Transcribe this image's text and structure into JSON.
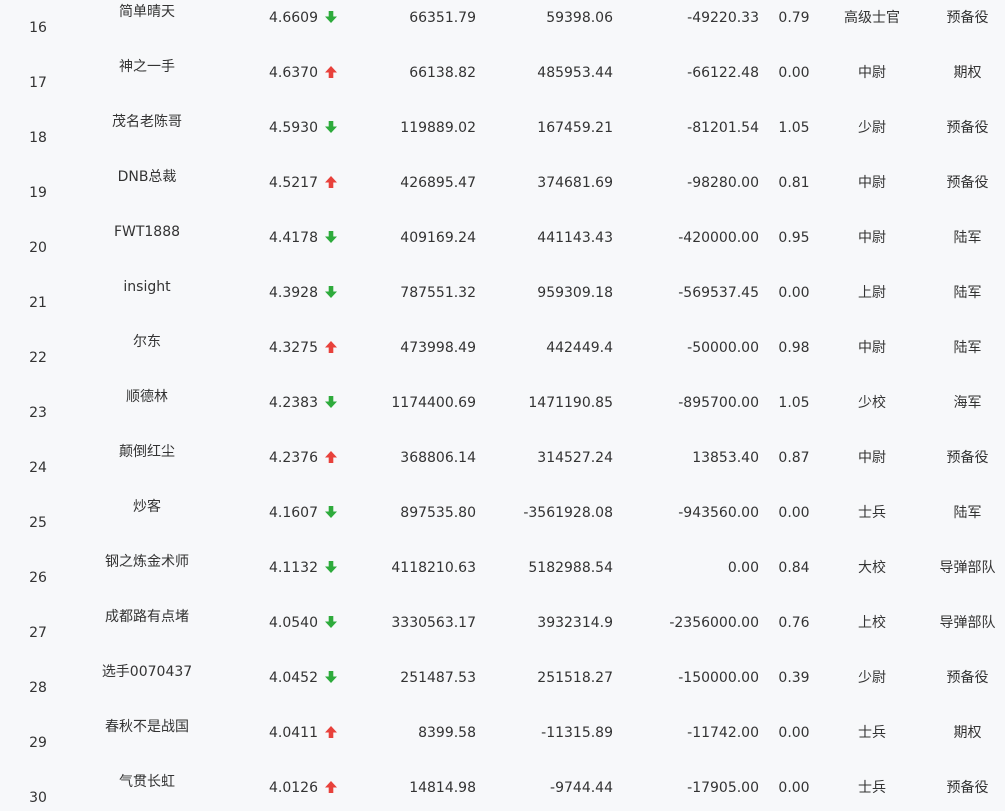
{
  "colors": {
    "up": "#e8413b",
    "down": "#2eab3c",
    "text": "#333333",
    "background": "#f7f8fa"
  },
  "rows": [
    {
      "rank": "16",
      "name": "简单晴天",
      "score": "4.6609",
      "trend": "down",
      "v1": "66351.79",
      "v2": "59398.06",
      "v3": "-49220.33",
      "ratio": "0.79",
      "level": "高级士官",
      "type": "预备役"
    },
    {
      "rank": "17",
      "name": "神之一手",
      "score": "4.6370",
      "trend": "up",
      "v1": "66138.82",
      "v2": "485953.44",
      "v3": "-66122.48",
      "ratio": "0.00",
      "level": "中尉",
      "type": "期权"
    },
    {
      "rank": "18",
      "name": "茂名老陈哥",
      "score": "4.5930",
      "trend": "down",
      "v1": "119889.02",
      "v2": "167459.21",
      "v3": "-81201.54",
      "ratio": "1.05",
      "level": "少尉",
      "type": "预备役"
    },
    {
      "rank": "19",
      "name": "DNB总裁",
      "score": "4.5217",
      "trend": "up",
      "v1": "426895.47",
      "v2": "374681.69",
      "v3": "-98280.00",
      "ratio": "0.81",
      "level": "中尉",
      "type": "预备役"
    },
    {
      "rank": "20",
      "name": "FWT1888",
      "score": "4.4178",
      "trend": "down",
      "v1": "409169.24",
      "v2": "441143.43",
      "v3": "-420000.00",
      "ratio": "0.95",
      "level": "中尉",
      "type": "陆军"
    },
    {
      "rank": "21",
      "name": "insight",
      "score": "4.3928",
      "trend": "down",
      "v1": "787551.32",
      "v2": "959309.18",
      "v3": "-569537.45",
      "ratio": "0.00",
      "level": "上尉",
      "type": "陆军"
    },
    {
      "rank": "22",
      "name": "尔东",
      "score": "4.3275",
      "trend": "up",
      "v1": "473998.49",
      "v2": "442449.4",
      "v3": "-50000.00",
      "ratio": "0.98",
      "level": "中尉",
      "type": "陆军"
    },
    {
      "rank": "23",
      "name": "顺德林",
      "score": "4.2383",
      "trend": "down",
      "v1": "1174400.69",
      "v2": "1471190.85",
      "v3": "-895700.00",
      "ratio": "1.05",
      "level": "少校",
      "type": "海军"
    },
    {
      "rank": "24",
      "name": "颠倒红尘",
      "score": "4.2376",
      "trend": "up",
      "v1": "368806.14",
      "v2": "314527.24",
      "v3": "13853.40",
      "ratio": "0.87",
      "level": "中尉",
      "type": "预备役"
    },
    {
      "rank": "25",
      "name": "炒客",
      "score": "4.1607",
      "trend": "down",
      "v1": "897535.80",
      "v2": "-3561928.08",
      "v3": "-943560.00",
      "ratio": "0.00",
      "level": "士兵",
      "type": "陆军"
    },
    {
      "rank": "26",
      "name": "钢之炼金术师",
      "score": "4.1132",
      "trend": "down",
      "v1": "4118210.63",
      "v2": "5182988.54",
      "v3": "0.00",
      "ratio": "0.84",
      "level": "大校",
      "type": "导弹部队"
    },
    {
      "rank": "27",
      "name": "成都路有点堵",
      "score": "4.0540",
      "trend": "down",
      "v1": "3330563.17",
      "v2": "3932314.9",
      "v3": "-2356000.00",
      "ratio": "0.76",
      "level": "上校",
      "type": "导弹部队"
    },
    {
      "rank": "28",
      "name": "选手0070437",
      "score": "4.0452",
      "trend": "down",
      "v1": "251487.53",
      "v2": "251518.27",
      "v3": "-150000.00",
      "ratio": "0.39",
      "level": "少尉",
      "type": "预备役"
    },
    {
      "rank": "29",
      "name": "春秋不是战国",
      "score": "4.0411",
      "trend": "up",
      "v1": "8399.58",
      "v2": "-11315.89",
      "v3": "-11742.00",
      "ratio": "0.00",
      "level": "士兵",
      "type": "期权"
    },
    {
      "rank": "30",
      "name": "气贯长虹",
      "score": "4.0126",
      "trend": "up",
      "v1": "14814.98",
      "v2": "-9744.44",
      "v3": "-17905.00",
      "ratio": "0.00",
      "level": "士兵",
      "type": "预备役"
    }
  ]
}
